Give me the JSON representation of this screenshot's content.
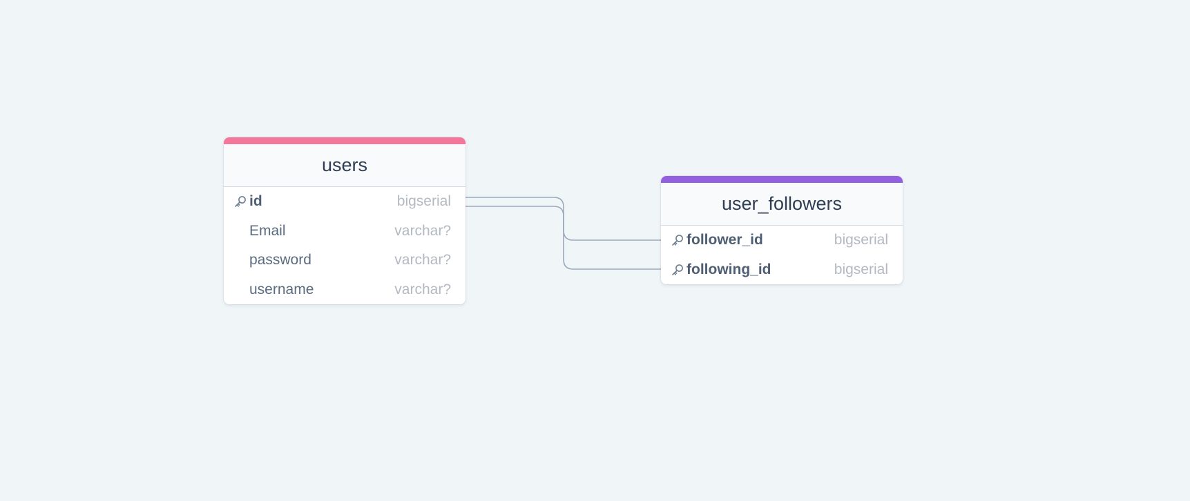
{
  "tables": [
    {
      "name": "users",
      "accent": "#f4769a",
      "columns": [
        {
          "name": "id",
          "type": "bigserial",
          "pk": true
        },
        {
          "name": "Email",
          "type": "varchar?",
          "pk": false
        },
        {
          "name": "password",
          "type": "varchar?",
          "pk": false
        },
        {
          "name": "username",
          "type": "varchar?",
          "pk": false
        }
      ]
    },
    {
      "name": "user_followers",
      "accent": "#9361e0",
      "columns": [
        {
          "name": "follower_id",
          "type": "bigserial",
          "pk": true
        },
        {
          "name": "following_id",
          "type": "bigserial",
          "pk": true
        }
      ]
    }
  ],
  "relations": [
    {
      "from": "users.id",
      "to": "user_followers.follower_id"
    },
    {
      "from": "users.id",
      "to": "user_followers.following_id"
    }
  ],
  "icons": {
    "primary_key": "key-icon"
  }
}
